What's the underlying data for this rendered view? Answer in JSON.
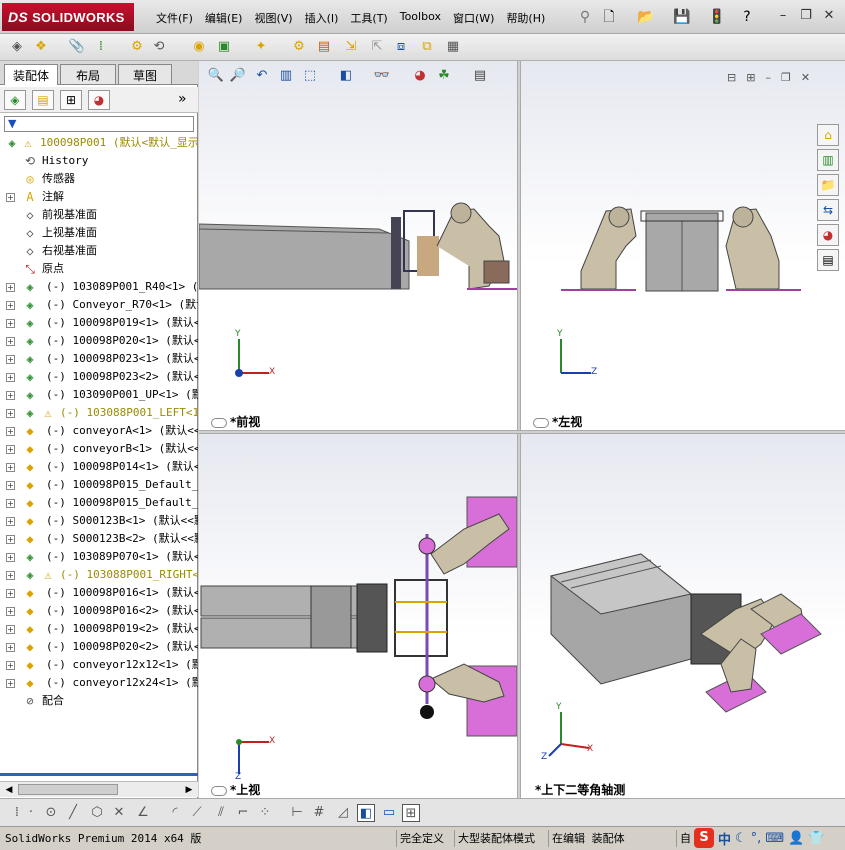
{
  "app": {
    "logo_prefix": "DS",
    "logo_text": "SOLIDWORKS"
  },
  "menu": [
    "文件(F)",
    "编辑(E)",
    "视图(V)",
    "插入(I)",
    "工具(T)",
    "Toolbox",
    "窗口(W)",
    "帮助(H)"
  ],
  "left_panel": {
    "tabs": [
      "装配体",
      "布局",
      "草图"
    ],
    "filter_symbol": "▼",
    "collapse_symbol": "»",
    "tree": [
      {
        "label": "100098P001  (默认<默认_显示",
        "icon": "assembly-warning-icon",
        "kind": "top"
      },
      {
        "label": "History",
        "icon": "history-icon",
        "kind": "folder"
      },
      {
        "label": "传感器",
        "icon": "sensor-icon",
        "kind": "folder"
      },
      {
        "label": "注解",
        "icon": "annotation-icon",
        "kind": "folder",
        "expand": true
      },
      {
        "label": "前视基准面",
        "icon": "plane-icon",
        "kind": "plane"
      },
      {
        "label": "上视基准面",
        "icon": "plane-icon",
        "kind": "plane"
      },
      {
        "label": "右视基准面",
        "icon": "plane-icon",
        "kind": "plane"
      },
      {
        "label": "原点",
        "icon": "origin-icon",
        "kind": "plane"
      },
      {
        "label": "(-) 103089P001_R40<1> (默认",
        "icon": "subassembly-icon",
        "kind": "part"
      },
      {
        "label": "(-) Conveyor_R70<1> (默认<",
        "icon": "subassembly-icon",
        "kind": "part"
      },
      {
        "label": "(-) 100098P019<1> (默认<<9",
        "icon": "subassembly-icon",
        "kind": "part"
      },
      {
        "label": "(-) 100098P020<1> (默认<<9",
        "icon": "subassembly-icon",
        "kind": "part"
      },
      {
        "label": "(-) 100098P023<1> (默认<<9",
        "icon": "subassembly-icon",
        "kind": "part"
      },
      {
        "label": "(-) 100098P023<2> (默认<<9",
        "icon": "subassembly-icon",
        "kind": "part"
      },
      {
        "label": "(-) 103090P001_UP<1> (默认",
        "icon": "subassembly-icon",
        "kind": "part"
      },
      {
        "label": "(-) 103088P001_LEFT<1>",
        "icon": "subassembly-warning-icon",
        "kind": "warn"
      },
      {
        "label": "(-) conveyorA<1> (默认<<默",
        "icon": "part-icon",
        "kind": "part"
      },
      {
        "label": "(-) conveyorB<1> (默认<<默",
        "icon": "part-icon",
        "kind": "part"
      },
      {
        "label": "(-) 100098P014<1> (默认<<9",
        "icon": "part-icon",
        "kind": "part"
      },
      {
        "label": "(-) 100098P015_Default_As",
        "icon": "part-icon",
        "kind": "part"
      },
      {
        "label": "(-) 100098P015_Default_As",
        "icon": "part-icon",
        "kind": "part"
      },
      {
        "label": "(-) S000123B<1> (默认<<默",
        "icon": "part-icon",
        "kind": "part"
      },
      {
        "label": "(-) S000123B<2> (默认<<默",
        "icon": "part-icon",
        "kind": "part"
      },
      {
        "label": "(-) 103089P070<1> (默认<9",
        "icon": "subassembly-icon",
        "kind": "part"
      },
      {
        "label": "(-) 103088P001_RIGHT<1>",
        "icon": "subassembly-warning-icon",
        "kind": "warn"
      },
      {
        "label": "(-) 100098P016<1> (默认<<9",
        "icon": "part-icon",
        "kind": "part"
      },
      {
        "label": "(-) 100098P016<2> (默认<<9",
        "icon": "part-icon",
        "kind": "part"
      },
      {
        "label": "(-) 100098P019<2> (默认<<9",
        "icon": "part-icon",
        "kind": "part"
      },
      {
        "label": "(-) 100098P020<2> (默认<<9",
        "icon": "part-icon",
        "kind": "part"
      },
      {
        "label": "(-) conveyor12x12<1> (默认",
        "icon": "part-icon",
        "kind": "part"
      },
      {
        "label": "(-) conveyor12x24<1> (默认",
        "icon": "part-icon",
        "kind": "part"
      },
      {
        "label": "配合",
        "icon": "mates-icon",
        "kind": "folder"
      }
    ]
  },
  "viewports": {
    "front": {
      "label": "*前视",
      "axis_v": "Y",
      "axis_h": "X"
    },
    "left": {
      "label": "*左视",
      "axis_v": "Y",
      "axis_h": "Z"
    },
    "top": {
      "label": "*上视",
      "axis_v": "X",
      "axis_h": "Z"
    },
    "iso": {
      "label": "*上下二等角轴测",
      "axis_v": "Y",
      "axis_h": "X",
      "axis_d": "Z"
    }
  },
  "status": {
    "product": "SolidWorks Premium 2014 x64 版",
    "defined": "完全定义",
    "mode": "大型装配体模式",
    "editing": "在编辑 装配体",
    "custom": "自"
  },
  "ime": {
    "logo": "S",
    "lang": "中"
  },
  "colors": {
    "brand": "#c8102e",
    "selection": "#3060c0",
    "pad_magenta": "#d86fd8",
    "model_gray": "#a0a0a0"
  }
}
